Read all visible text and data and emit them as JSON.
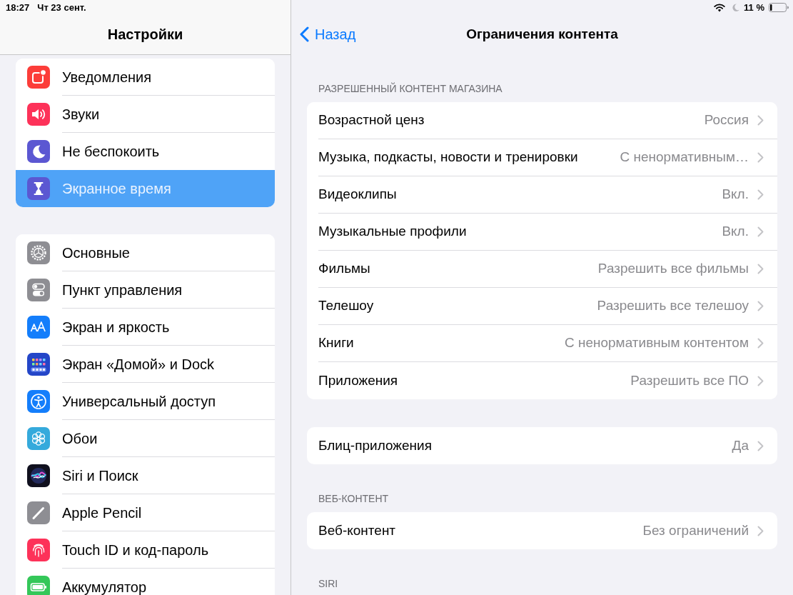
{
  "status_bar": {
    "time": "18:27",
    "date": "Чт 23 сент.",
    "battery": "11 %"
  },
  "sidebar": {
    "title": "Настройки",
    "groups": [
      {
        "items": [
          {
            "label": "Уведомления",
            "selected": false
          },
          {
            "label": "Звуки",
            "selected": false
          },
          {
            "label": "Не беспокоить",
            "selected": false
          },
          {
            "label": "Экранное время",
            "selected": true
          }
        ]
      },
      {
        "items": [
          {
            "label": "Основные",
            "selected": false
          },
          {
            "label": "Пункт управления",
            "selected": false
          },
          {
            "label": "Экран и яркость",
            "selected": false
          },
          {
            "label": "Экран «Домой» и Dock",
            "selected": false
          },
          {
            "label": "Универсальный доступ",
            "selected": false
          },
          {
            "label": "Обои",
            "selected": false
          },
          {
            "label": "Siri и Поиск",
            "selected": false
          },
          {
            "label": "Apple Pencil",
            "selected": false
          },
          {
            "label": "Touch ID и код-пароль",
            "selected": false
          },
          {
            "label": "Аккумулятор",
            "selected": false
          }
        ]
      }
    ]
  },
  "detail": {
    "back": "Назад",
    "title": "Ограничения контента",
    "sections": [
      {
        "header": "РАЗРЕШЕННЫЙ КОНТЕНТ МАГАЗИНА",
        "rows": [
          {
            "label": "Возрастной ценз",
            "value": "Россия"
          },
          {
            "label": "Музыка, подкасты, новости и тренировки",
            "value": "С ненормативным…"
          },
          {
            "label": "Видеоклипы",
            "value": "Вкл."
          },
          {
            "label": "Музыкальные профили",
            "value": "Вкл."
          },
          {
            "label": "Фильмы",
            "value": "Разрешить все фильмы"
          },
          {
            "label": "Телешоу",
            "value": "Разрешить все телешоу"
          },
          {
            "label": "Книги",
            "value": "С ненормативным контентом"
          },
          {
            "label": "Приложения",
            "value": "Разрешить все ПО"
          }
        ]
      },
      {
        "rows": [
          {
            "label": "Блиц-приложения",
            "value": "Да"
          }
        ]
      },
      {
        "header": "ВЕБ-КОНТЕНТ",
        "rows": [
          {
            "label": "Веб-контент",
            "value": "Без ограничений"
          }
        ]
      },
      {
        "header": "SIRI"
      }
    ]
  }
}
